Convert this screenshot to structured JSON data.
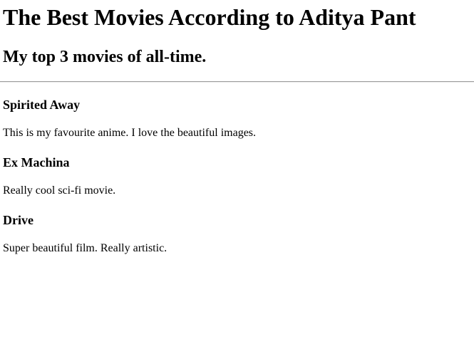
{
  "heading": "The Best Movies According to Aditya Pant",
  "subheading": "My top 3 movies of all-time.",
  "movies": [
    {
      "title": "Spirited Away",
      "description": "This is my favourite anime. I love the beautiful images."
    },
    {
      "title": "Ex Machina",
      "description": "Really cool sci-fi movie."
    },
    {
      "title": "Drive",
      "description": "Super beautiful film. Really artistic."
    }
  ]
}
